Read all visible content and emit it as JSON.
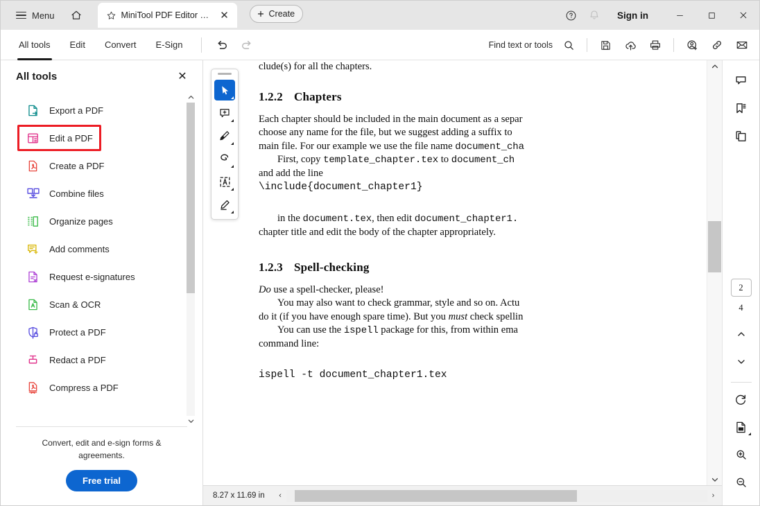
{
  "window": {
    "menu_label": "Menu",
    "home_icon": "home-icon",
    "help_icon": "help-circle-icon",
    "bell_icon": "bell-icon",
    "signin_label": "Sign in",
    "minimize_label": "–",
    "maximize_label": "❑",
    "close_label": "✕"
  },
  "tab": {
    "star_icon": "star-icon",
    "title": "MiniTool PDF Editor Use…",
    "close_label": "✕",
    "create_label": "Create",
    "create_plus": "+"
  },
  "toolbar": {
    "tabs": [
      {
        "label": "All tools",
        "active": true
      },
      {
        "label": "Edit",
        "active": false
      },
      {
        "label": "Convert",
        "active": false
      },
      {
        "label": "E-Sign",
        "active": false
      }
    ],
    "undo_icon": "undo-icon",
    "redo_icon": "redo-icon",
    "find_label": "Find text or tools",
    "search_icon": "search-icon",
    "actions": [
      {
        "name": "save-icon"
      },
      {
        "name": "upload-cloud-icon"
      },
      {
        "name": "print-icon"
      },
      {
        "name": "add-person-icon"
      },
      {
        "name": "link-icon"
      },
      {
        "name": "email-icon"
      }
    ]
  },
  "tools_panel": {
    "title": "All tools",
    "close_label": "✕",
    "items": [
      {
        "label": "Export a PDF",
        "icon": "export-pdf-icon",
        "color": "#0e8c8c",
        "highlighted": false
      },
      {
        "label": "Edit a PDF",
        "icon": "edit-pdf-icon",
        "color": "#e1338c",
        "highlighted": true
      },
      {
        "label": "Create a PDF",
        "icon": "create-pdf-icon",
        "color": "#e8483f",
        "highlighted": false
      },
      {
        "label": "Combine files",
        "icon": "combine-files-icon",
        "color": "#5a4fe0",
        "highlighted": false
      },
      {
        "label": "Organize pages",
        "icon": "organize-pages-icon",
        "color": "#3cbb4a",
        "highlighted": false
      },
      {
        "label": "Add comments",
        "icon": "add-comments-icon",
        "color": "#d9b80a",
        "highlighted": false
      },
      {
        "label": "Request e-signatures",
        "icon": "request-esign-icon",
        "color": "#b046d6",
        "highlighted": false
      },
      {
        "label": "Scan & OCR",
        "icon": "scan-ocr-icon",
        "color": "#3cbb4a",
        "highlighted": false
      },
      {
        "label": "Protect a PDF",
        "icon": "protect-pdf-icon",
        "color": "#5a4fe0",
        "highlighted": false
      },
      {
        "label": "Redact a PDF",
        "icon": "redact-pdf-icon",
        "color": "#e1338c",
        "highlighted": false
      },
      {
        "label": "Compress a PDF",
        "icon": "compress-pdf-icon",
        "color": "#e8483f",
        "highlighted": false
      }
    ],
    "highlight_color": "#ec1c24",
    "footer_text": "Convert, edit and e-sign forms & agreements.",
    "cta_label": "Free trial",
    "cta_color": "#0d66d0"
  },
  "vertical_toolbar": {
    "buttons": [
      {
        "name": "select-tool",
        "active": true
      },
      {
        "name": "add-comment-tool",
        "active": false
      },
      {
        "name": "highlight-tool",
        "active": false
      },
      {
        "name": "draw-tool",
        "active": false
      },
      {
        "name": "text-box-tool",
        "active": false
      },
      {
        "name": "signature-tool",
        "active": false
      }
    ]
  },
  "document": {
    "cut_line": "clude(s) for all the chapters.",
    "heading1": {
      "num": "1.2.2",
      "title": "Chapters"
    },
    "para1_a": "Each chapter should be included in the main document as a separ",
    "para1_b": "choose any name for the file, but we suggest adding a suffix to",
    "para1_c_pre": "main file. For our example we use the file name ",
    "para1_c_mono": "document_cha",
    "para2_pre": "First, copy ",
    "para2_mono1": "template_chapter.tex",
    "para2_mid": " to ",
    "para2_mono2": "document_ch",
    "para2_next": "and add the line",
    "code1": "\\include{document_chapter1}",
    "para3_pre": "in the ",
    "para3_mono1": "document.tex",
    "para3_mid": ", then edit ",
    "para3_mono2": "document_chapter1.",
    "para3_next": "chapter title and edit the body of the chapter appropriately.",
    "heading2": {
      "num": "1.2.3",
      "title": "Spell-checking"
    },
    "para4_ital": "Do",
    "para4_rest": " use a spell-checker, please!",
    "para5_a": "You may also want to check grammar, style and so on.  Actu",
    "para5_b_pre": "do it (if you have enough spare time). But you ",
    "para5_b_ital": "must",
    "para5_b_post": " check spellin",
    "para6_pre": "You can use the ",
    "para6_mono": "ispell",
    "para6_post": " package for this, from within ema",
    "para6_next": "command line:",
    "code2": "ispell -t document_chapter1.tex"
  },
  "status_bar": {
    "page_size": "8.27 x 11.69 in",
    "scroll_left": "‹",
    "scroll_right": "›"
  },
  "right_rail": {
    "top_buttons": [
      {
        "name": "comments-icon"
      },
      {
        "name": "bookmarks-icon"
      },
      {
        "name": "page-thumbnails-icon"
      }
    ],
    "current_page": "2",
    "total_pages": "4",
    "prev_page_icon": "chevron-up-icon",
    "next_page_icon": "chevron-down-icon",
    "rotate_icon": "rotate-icon",
    "fit_icon": "fit-page-icon",
    "zoom_in_icon": "zoom-in-icon",
    "zoom_out_icon": "zoom-out-icon"
  }
}
